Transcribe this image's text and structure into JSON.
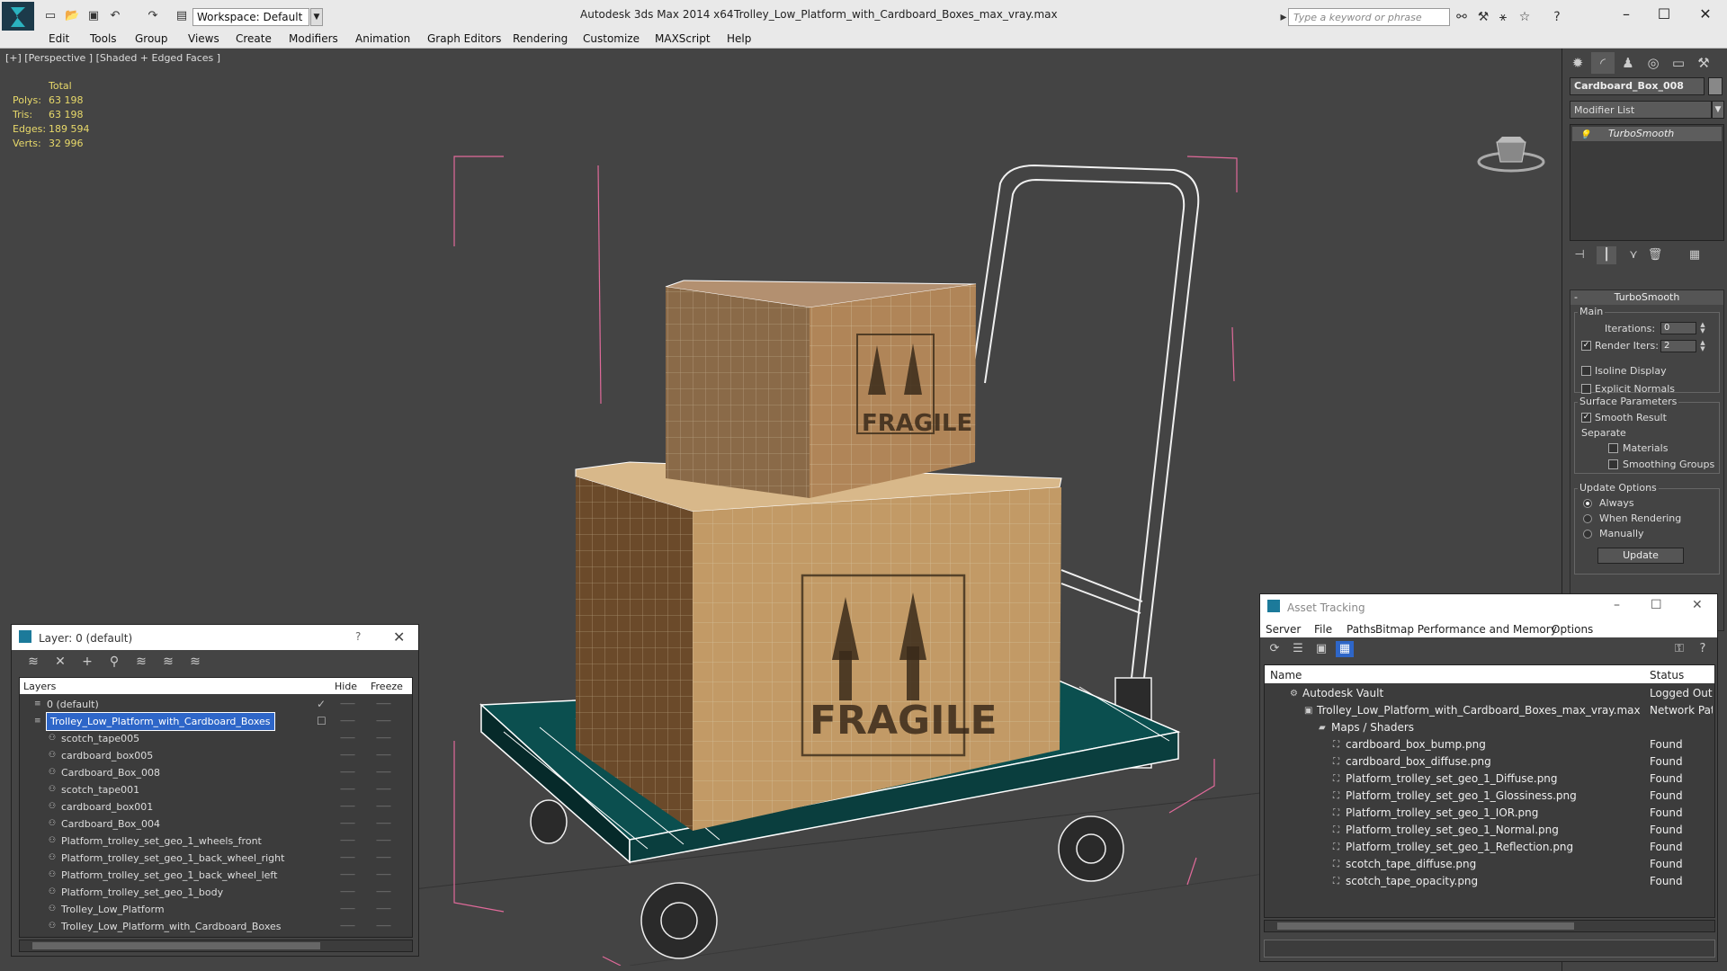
{
  "titlebar": {
    "workspace": "Workspace: Default",
    "app_title": "Autodesk 3ds Max  2014 x64",
    "file_title": "Trolley_Low_Platform_with_Cardboard_Boxes_max_vray.max",
    "search_placeholder": "Type a keyword or phrase"
  },
  "menu": [
    "Edit",
    "Tools",
    "Group",
    "Views",
    "Create",
    "Modifiers",
    "Animation",
    "Graph Editors",
    "Rendering",
    "Customize",
    "MAXScript",
    "Help"
  ],
  "viewport": {
    "label": "[+] [Perspective ] [Shaded + Edged Faces ]",
    "stats": {
      "header": "Total",
      "polys_label": "Polys:",
      "polys": "63 198",
      "tris_label": "Tris:",
      "tris": "63 198",
      "edges_label": "Edges:",
      "edges": "189 594",
      "verts_label": "Verts:",
      "verts": "32 996"
    },
    "box_label": "FRAGILE"
  },
  "command_panel": {
    "object_name": "Cardboard_Box_008",
    "modifier_list": "Modifier List",
    "stack_item": "TurboSmooth",
    "rollout_title": "TurboSmooth",
    "main_group": "Main",
    "iterations_label": "Iterations:",
    "iterations": "0",
    "render_iters_label": "Render Iters:",
    "render_iters": "2",
    "isoline_label": "Isoline Display",
    "explicit_normals_label": "Explicit Normals",
    "surface_group": "Surface Parameters",
    "smooth_result_label": "Smooth Result",
    "separate_label": "Separate",
    "materials_label": "Materials",
    "smoothing_groups_label": "Smoothing Groups",
    "update_group": "Update Options",
    "always_label": "Always",
    "when_rendering_label": "When Rendering",
    "manually_label": "Manually",
    "update_button": "Update"
  },
  "layer_window": {
    "title": "Layer: 0 (default)",
    "help": "?",
    "col_layers": "Layers",
    "col_hide": "Hide",
    "col_freeze": "Freeze",
    "rows": [
      {
        "name": "0 (default)",
        "level": 0
      },
      {
        "name": "Trolley_Low_Platform_with_Cardboard_Boxes",
        "level": 0
      },
      {
        "name": "scotch_tape005",
        "level": 1
      },
      {
        "name": "cardboard_box005",
        "level": 1
      },
      {
        "name": "Cardboard_Box_008",
        "level": 1
      },
      {
        "name": "scotch_tape001",
        "level": 1
      },
      {
        "name": "cardboard_box001",
        "level": 1
      },
      {
        "name": "Cardboard_Box_004",
        "level": 1
      },
      {
        "name": "Platform_trolley_set_geo_1_wheels_front",
        "level": 1
      },
      {
        "name": "Platform_trolley_set_geo_1_back_wheel_right",
        "level": 1
      },
      {
        "name": "Platform_trolley_set_geo_1_back_wheel_left",
        "level": 1
      },
      {
        "name": "Platform_trolley_set_geo_1_body",
        "level": 1
      },
      {
        "name": "Trolley_Low_Platform",
        "level": 1
      },
      {
        "name": "Trolley_Low_Platform_with_Cardboard_Boxes",
        "level": 1
      }
    ]
  },
  "asset_window": {
    "title": "Asset Tracking",
    "menu": [
      "Server",
      "File",
      "Paths",
      "Bitmap Performance and Memory",
      "Options"
    ],
    "col_name": "Name",
    "col_status": "Status",
    "rows": [
      {
        "name": "Autodesk Vault",
        "status": "Logged Out ..",
        "level": 0
      },
      {
        "name": "Trolley_Low_Platform_with_Cardboard_Boxes_max_vray.max",
        "status": "Network Path",
        "level": 1
      },
      {
        "name": "Maps / Shaders",
        "status": "",
        "level": 2
      },
      {
        "name": "cardboard_box_bump.png",
        "status": "Found",
        "level": 3
      },
      {
        "name": "cardboard_box_diffuse.png",
        "status": "Found",
        "level": 3
      },
      {
        "name": "Platform_trolley_set_geo_1_Diffuse.png",
        "status": "Found",
        "level": 3
      },
      {
        "name": "Platform_trolley_set_geo_1_Glossiness.png",
        "status": "Found",
        "level": 3
      },
      {
        "name": "Platform_trolley_set_geo_1_IOR.png",
        "status": "Found",
        "level": 3
      },
      {
        "name": "Platform_trolley_set_geo_1_Normal.png",
        "status": "Found",
        "level": 3
      },
      {
        "name": "Platform_trolley_set_geo_1_Reflection.png",
        "status": "Found",
        "level": 3
      },
      {
        "name": "scotch_tape_diffuse.png",
        "status": "Found",
        "level": 3
      },
      {
        "name": "scotch_tape_opacity.png",
        "status": "Found",
        "level": 3
      }
    ]
  },
  "colors": {
    "stats_text": "#e8d96a",
    "selection": "#2e66c8",
    "bounding_box": "#e06a9a"
  }
}
